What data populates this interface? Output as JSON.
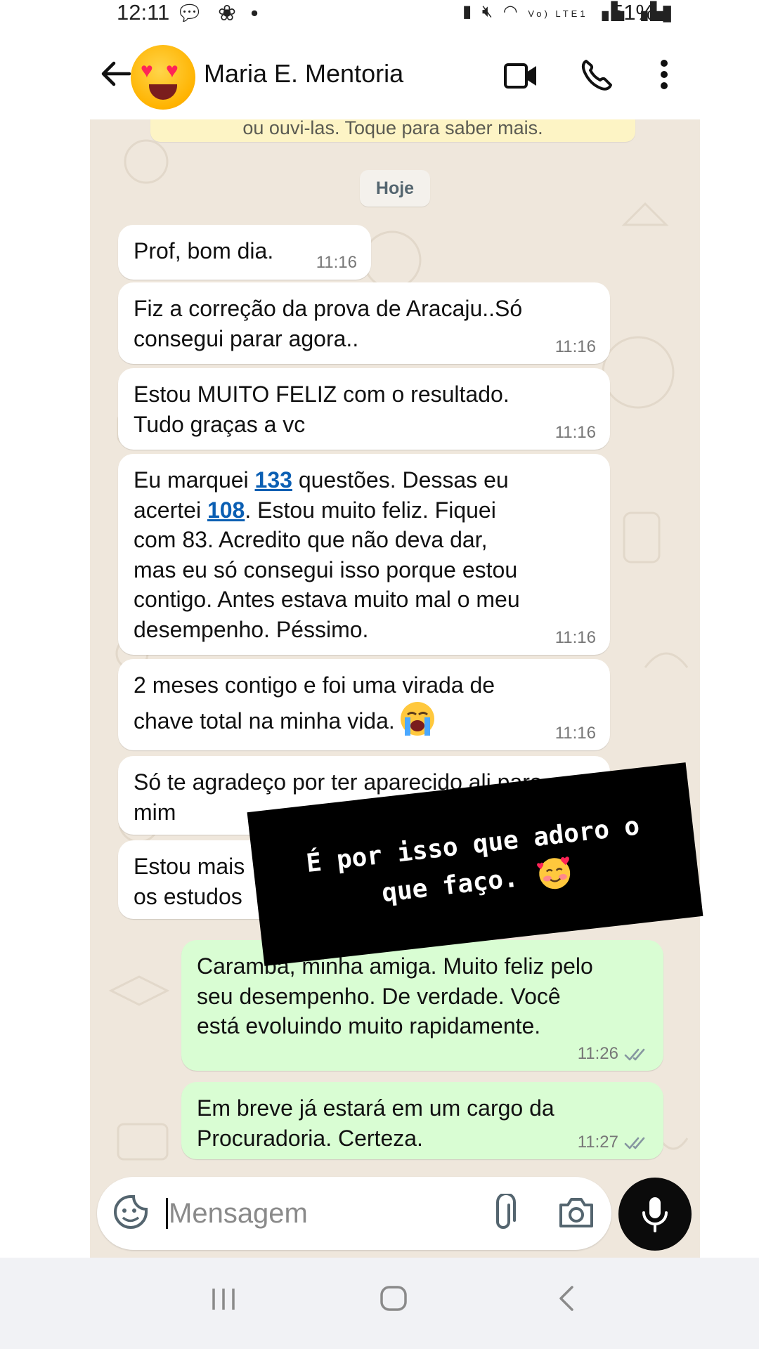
{
  "status_bar": {
    "time": "12:11",
    "left_icons": [
      "chat-bubble-icon",
      "pinwheel-icon",
      "dot-icon"
    ],
    "right_icons": [
      "battery-saver-icon",
      "mute-icon",
      "wifi-icon",
      "volte-icon",
      "signal-icon",
      "signal-icon"
    ],
    "network_label": "Vo) LTE1",
    "battery": "51%"
  },
  "app_bar": {
    "contact_name": "Maria E. Mentoria",
    "avatar": "heart-eyes-emoji",
    "icons": [
      "back-arrow-icon",
      "video-call-icon",
      "phone-icon",
      "more-vert-icon"
    ]
  },
  "banner": {
    "text": "ou ouvi-las. Toque para saber mais."
  },
  "date_chip": "Hoje",
  "messages": [
    {
      "dir": "in",
      "text": "Prof, bom dia.",
      "time": "11:16"
    },
    {
      "dir": "in",
      "text": "Fiz a correção da prova de Aracaju..Só\nconsegui parar agora..",
      "time": "11:16"
    },
    {
      "dir": "in",
      "text": "Estou MUITO FELIZ com o resultado.\nTudo graças a vc",
      "time": "11:16"
    },
    {
      "dir": "in",
      "parts": {
        "p1": "Eu marquei ",
        "l1": "133",
        "p2": " questões. Dessas eu\nacertei ",
        "l2": "108",
        "p3": ". Estou muito feliz. Fiquei\ncom 83. Acredito que não deva dar,\nmas eu só consegui isso porque estou\ncontigo. Antes estava muito mal o meu\ndesempenho. Péssimo."
      },
      "time": "11:16"
    },
    {
      "dir": "in",
      "text": "2 meses contigo e foi uma virada de\nchave total na minha vida.",
      "emoji": "loudly-crying-face",
      "time": "11:16"
    },
    {
      "dir": "in",
      "text": "Só te agradeço por ter aparecido ali para\nmim"
    },
    {
      "dir": "in",
      "text": "Estou mais\nos estudos"
    },
    {
      "dir": "out",
      "text": "Caramba, minha amiga. Muito feliz pelo\nseu desempenho. De verdade. Você\nestá evoluindo muito rapidamente.",
      "time": "11:26",
      "status": "read"
    },
    {
      "dir": "out",
      "text": "Em breve já estará em um cargo da\nProcuradoria. Certeza.",
      "time": "11:27",
      "status": "read"
    }
  ],
  "overlay": {
    "text": "É por isso que adoro o que faço.",
    "emoji": "smiling-face-with-hearts"
  },
  "input": {
    "placeholder": "Mensagem",
    "value": ""
  },
  "nav_bar": [
    "recents-icon",
    "home-icon",
    "back-icon"
  ],
  "colors": {
    "chat_background": "#efe7dc",
    "incoming_bubble": "#ffffff",
    "outgoing_bubble": "#d9fdd3",
    "link": "#0b5fb3",
    "read_ticks": "#8696a0",
    "mic_button": "#0b0b0b",
    "banner": "#fdf4c5"
  }
}
